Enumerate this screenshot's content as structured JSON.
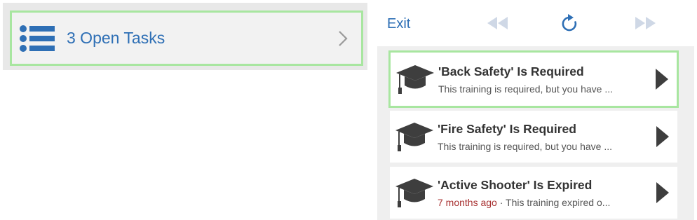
{
  "open_tasks": {
    "label": "3 Open Tasks",
    "icon": "list-icon",
    "chevron_icon": "chevron-right-icon",
    "accent_color": "#2e6fb5",
    "highlight_color": "#a8e6a0"
  },
  "toolbar": {
    "exit_label": "Exit",
    "rewind_icon": "rewind-icon",
    "refresh_icon": "refresh-icon",
    "forward_icon": "fast-forward-icon"
  },
  "trainings": [
    {
      "title": "'Back Safety' Is Required",
      "subtitle": "This training is required, but you have ...",
      "age": "",
      "selected": true,
      "icon": "graduation-cap-icon"
    },
    {
      "title": "'Fire Safety' Is Required",
      "subtitle": "This training is required, but you have ...",
      "age": "",
      "selected": false,
      "icon": "graduation-cap-icon"
    },
    {
      "title": "'Active Shooter' Is Expired",
      "subtitle": " · This training expired o...",
      "age": "7 months ago",
      "age_color": "#a83232",
      "selected": false,
      "icon": "graduation-cap-icon"
    }
  ]
}
